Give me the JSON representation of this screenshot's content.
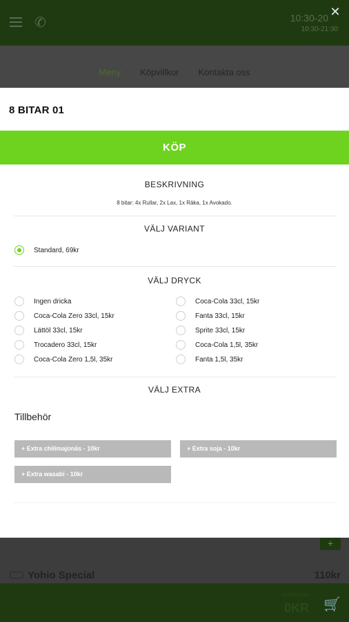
{
  "background": {
    "header_hours": "10:30-20",
    "header_hours_sub": "10:30-21:30",
    "nav": [
      "Meny",
      "Köpvillkor",
      "Kontakta oss"
    ],
    "item_name": "Yohio Special",
    "item_price": "110kr",
    "cart_label": "KUNDVAGN",
    "cart_value": "0KR",
    "add_label": "+"
  },
  "modal": {
    "title": "8 BITAR 01",
    "buy_label": "KÖP",
    "description_heading": "BESKRIVNING",
    "description_text": "8 bitar: 4x Rullar, 2x Lax, 1x Räka, 1x Avokado.",
    "variant_heading": "VÄLJ VARIANT",
    "variants": [
      {
        "label": "Standard, 69kr",
        "checked": true
      }
    ],
    "drink_heading": "VÄLJ DRYCK",
    "drinks_left": [
      "Ingen dricka",
      "Coca-Cola Zero 33cl, 15kr",
      "Lättöl 33cl, 15kr",
      "Trocadero 33cl, 15kr",
      "Coca-Cola Zero 1,5l, 35kr"
    ],
    "drinks_right": [
      "Coca-Cola 33cl, 15kr",
      "Fanta 33cl, 15kr",
      "Sprite 33cl, 15kr",
      "Coca-Cola 1,5l, 35kr",
      "Fanta 1,5l, 35kr"
    ],
    "extra_heading": "VÄLJ EXTRA",
    "accessories_heading": "Tillbehör",
    "extras": [
      "+ Extra chilimajonäs - 10kr",
      "+ Extra soja - 10kr",
      "+ Extra wasabi - 10kr"
    ]
  },
  "colors": {
    "accent": "#6dd31f",
    "header_bg": "#1f3a10",
    "extra_btn_bg": "#b9b9b9"
  }
}
